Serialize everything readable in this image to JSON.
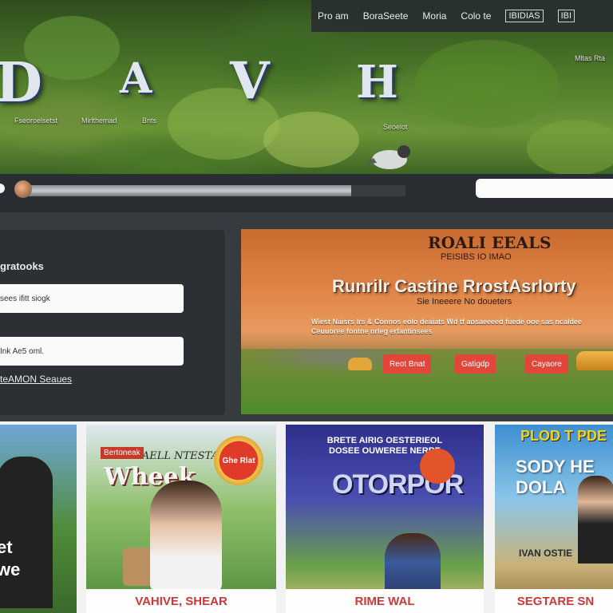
{
  "nav": {
    "items": [
      "Pro am",
      "BoraSeete",
      "Moria",
      "Colo te",
      "IBIDIAS",
      "IBI"
    ]
  },
  "hero": {
    "logo_letters": [
      "D",
      "A",
      "V",
      "H"
    ],
    "captions": [
      "Fseoroelsetst",
      "Mirlthemad",
      "Bnts",
      "Mltas Rta",
      "Seoelot"
    ]
  },
  "search": {
    "progress_fraction": 0.86,
    "placeholder": ""
  },
  "form": {
    "title": "gratooks",
    "field1": "sees ifitt siogk",
    "field2": "Ink Ae5 oml.",
    "link": "teAMON Seaues"
  },
  "promo": {
    "title": "ROALI EEALS",
    "subtitle": "PEISIBS IO IMAO",
    "headline": "Runrilr Castine RrostAsrlorty",
    "sub2": "Sie Ineeere No doueters",
    "description": "Wiest Naisrs Irs & Connos eolo deaiats Wd tf aosaeeeed fuede ooe sas ncaldee Ceuuoree fontne nrleg erfantinsees"
  },
  "promo_buttons": [
    "Reot Bnat",
    "Gatigdp",
    "Cayaore"
  ],
  "cards": [
    {
      "overlay": "et\nwe",
      "caption": ""
    },
    {
      "tag": "Bertoneak",
      "banner": "TROHAAELL NTESTATION",
      "big": "Wheek",
      "seal": "Ghe Rlat",
      "caption": "VAHIVE, SHEAR"
    },
    {
      "head": "BRETE AIRIG OESTERIEOL DOSEE OUWEREE NERRE",
      "title": "OTORPOR",
      "caption": "RIME WAL"
    },
    {
      "head": "PLOD T PDE",
      "big": "SODY HE\nDOLA",
      "sign": "IVAN OSTIE",
      "caption": "SEGTARE SN"
    }
  ]
}
